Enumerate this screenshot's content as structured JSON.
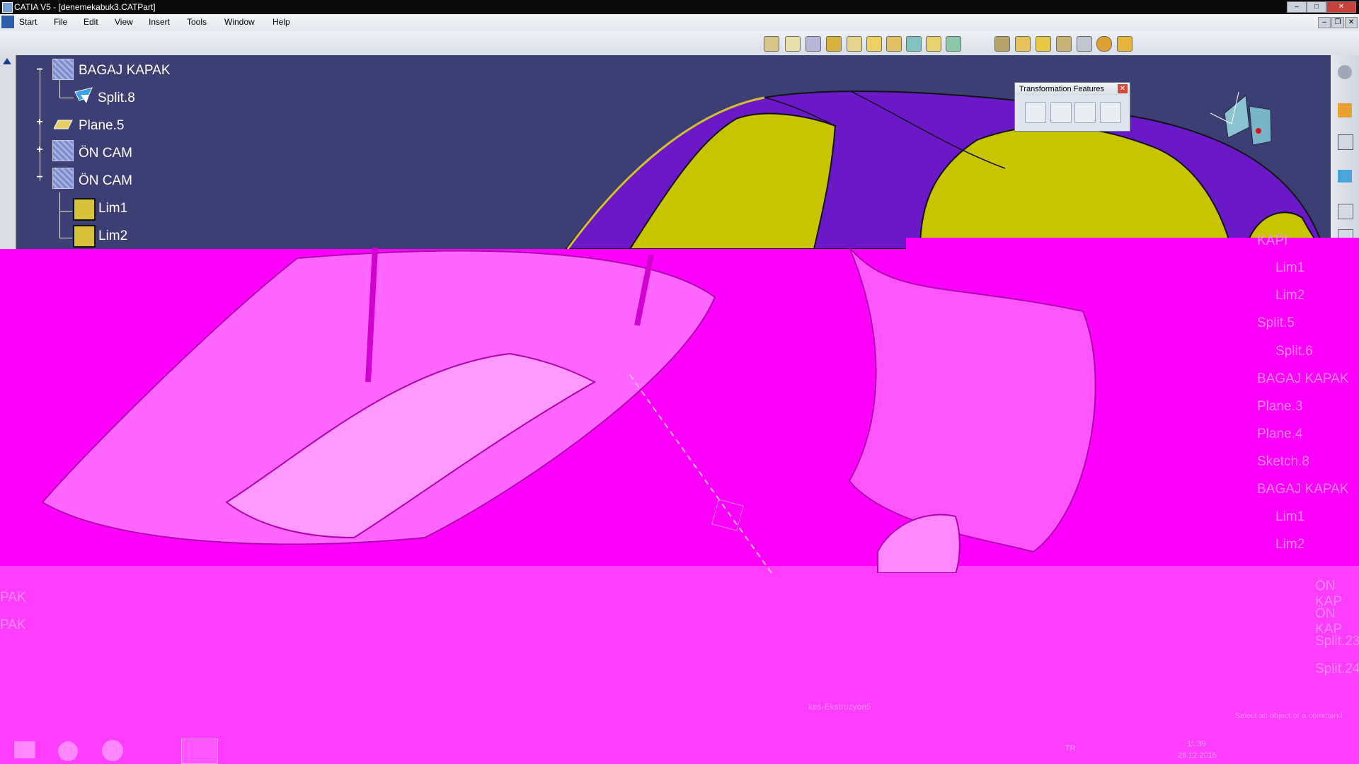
{
  "window": {
    "title": "CATIA V5 - [denemekabuk3.CATPart]",
    "min": "–",
    "max": "□",
    "close": "✕"
  },
  "doc_controls": {
    "min": "–",
    "restore": "❐",
    "close": "✕"
  },
  "menubar": [
    "Start",
    "File",
    "Edit",
    "View",
    "Insert",
    "Tools",
    "Window",
    "Help"
  ],
  "tree": {
    "nodes": [
      {
        "label": "BAGAJ KAPAK",
        "icon": "surface-icon",
        "expander": "minus"
      },
      {
        "label": "Split.8",
        "icon": "split-icon"
      },
      {
        "label": "Plane.5",
        "icon": "plane-icon",
        "expander": "plus"
      },
      {
        "label": "ÖN CAM",
        "icon": "surface-icon",
        "expander": "plus"
      },
      {
        "label": "ÖN CAM",
        "icon": "surface-icon",
        "expander": "minus"
      },
      {
        "label": "Lim1",
        "icon": "boundary-icon"
      },
      {
        "label": "Lim2",
        "icon": "boundary-icon"
      }
    ]
  },
  "transform_toolbar": {
    "title": "Transformation Features",
    "close": "✕"
  },
  "right_tree": {
    "labels": [
      "KAPI",
      "Lim1",
      "Lim2",
      "Split.5",
      "Split.6",
      "BAGAJ KAPAK",
      "Plane.3",
      "Plane.4",
      "Sketch.8",
      "BAGAJ KAPAK",
      "Lim1",
      "Lim2"
    ]
  },
  "lower_tree": {
    "left_labels": [
      "PAK",
      "PAK"
    ],
    "right_labels": [
      "ÖN KAP",
      "ÖN KAP",
      "Split.23",
      "Split.24"
    ]
  },
  "bottom_toolbar": {
    "combo_value": "kes-Ekstruzyon5"
  },
  "status": {
    "prompt": "Select an object or a command"
  },
  "taskbar": {
    "lang": "TR",
    "time": "11:39",
    "date": "26.12.2015"
  },
  "colors": {
    "purple_surface": "#6a18c8",
    "yellow_surface": "#c8c400",
    "background": "#3b3f73",
    "magenta": "#ff00ff"
  }
}
